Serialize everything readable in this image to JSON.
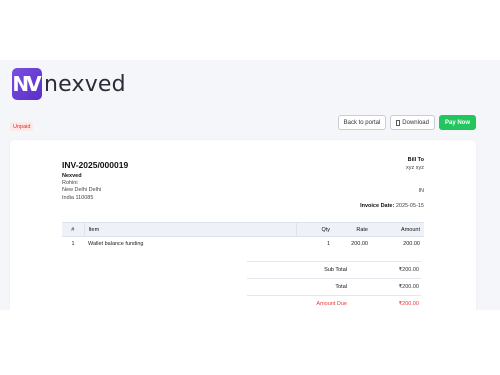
{
  "brand": {
    "mark": "NV",
    "name": "nexved"
  },
  "status": "Unpaid",
  "actions": {
    "back": "Back to portal",
    "download": "Download",
    "pay": "Pay Now"
  },
  "invoice": {
    "number": "INV-2025/000019",
    "from": {
      "company": "Nexved",
      "line1": "Rohini",
      "line2": "New Delhi Delhi",
      "line3": "India 110085"
    },
    "bill_to": {
      "label": "Bill To",
      "name": "xyz xyz",
      "country": "IN"
    },
    "date_label": "Invoice Date:",
    "date": "2025-05-15"
  },
  "table": {
    "headers": {
      "num": "#",
      "item": "Item",
      "qty": "Qty",
      "rate": "Rate",
      "amount": "Amount"
    },
    "rows": [
      {
        "num": "1",
        "item": "Wallet balance funding",
        "qty": "1",
        "rate": "200.00",
        "amount": "200.00"
      }
    ]
  },
  "totals": {
    "subtotal_label": "Sub Total",
    "subtotal": "₹200.00",
    "total_label": "Total",
    "total": "₹200.00",
    "due_label": "Amount Due",
    "due": "₹200.00"
  },
  "colors": {
    "accent": "#22c55e",
    "due": "#e23b3b",
    "brand": "#6a3fd6"
  }
}
